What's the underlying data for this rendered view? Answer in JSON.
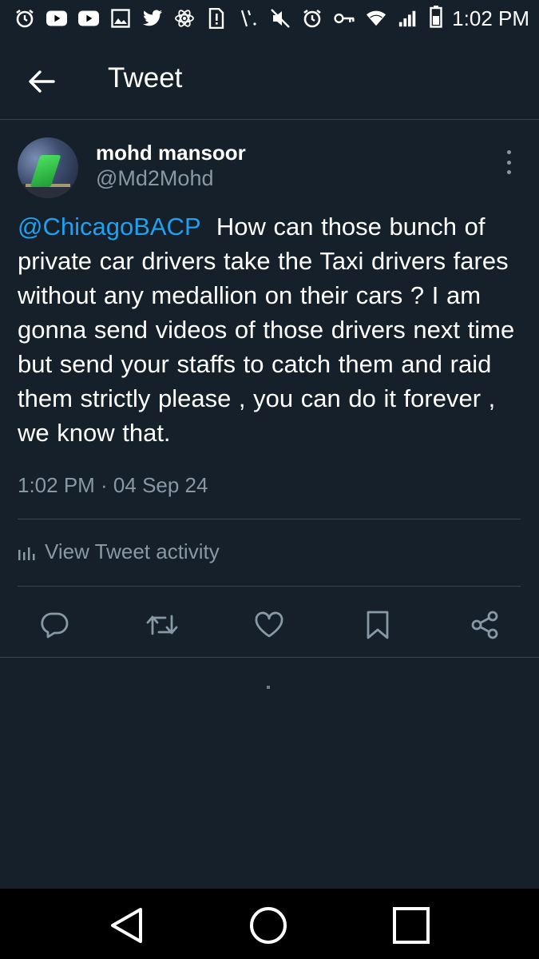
{
  "status_bar": {
    "time": "1:02 PM",
    "icons": [
      "alarm-icon",
      "youtube-icon",
      "youtube-icon",
      "gallery-icon",
      "twitter-icon",
      "react-icon",
      "sim-alert-icon",
      "signal-tick-icon",
      "mute-icon",
      "alarm-icon",
      "key-icon",
      "wifi-icon",
      "cell-signal-icon",
      "battery-icon"
    ]
  },
  "app_bar": {
    "title": "Tweet"
  },
  "tweet": {
    "author_name": "mohd mansoor",
    "author_handle": "@Md2Mohd",
    "mention": "@ChicagoBACP",
    "body": "How can those bunch of private car drivers take the Taxi drivers fares without any medallion on their cars ? I am gonna send videos of those drivers next time but send your staffs to catch them and raid them strictly please , you can do it forever , we know that.",
    "timestamp": "1:02 PM · 04 Sep 24",
    "activity_label": "View Tweet activity"
  },
  "actions": [
    "reply-icon",
    "retweet-icon",
    "like-icon",
    "bookmark-icon",
    "share-icon"
  ],
  "colors": {
    "background": "#15202b",
    "accent": "#1da1f2",
    "secondary_text": "#8899a6",
    "divider": "#38444d"
  }
}
